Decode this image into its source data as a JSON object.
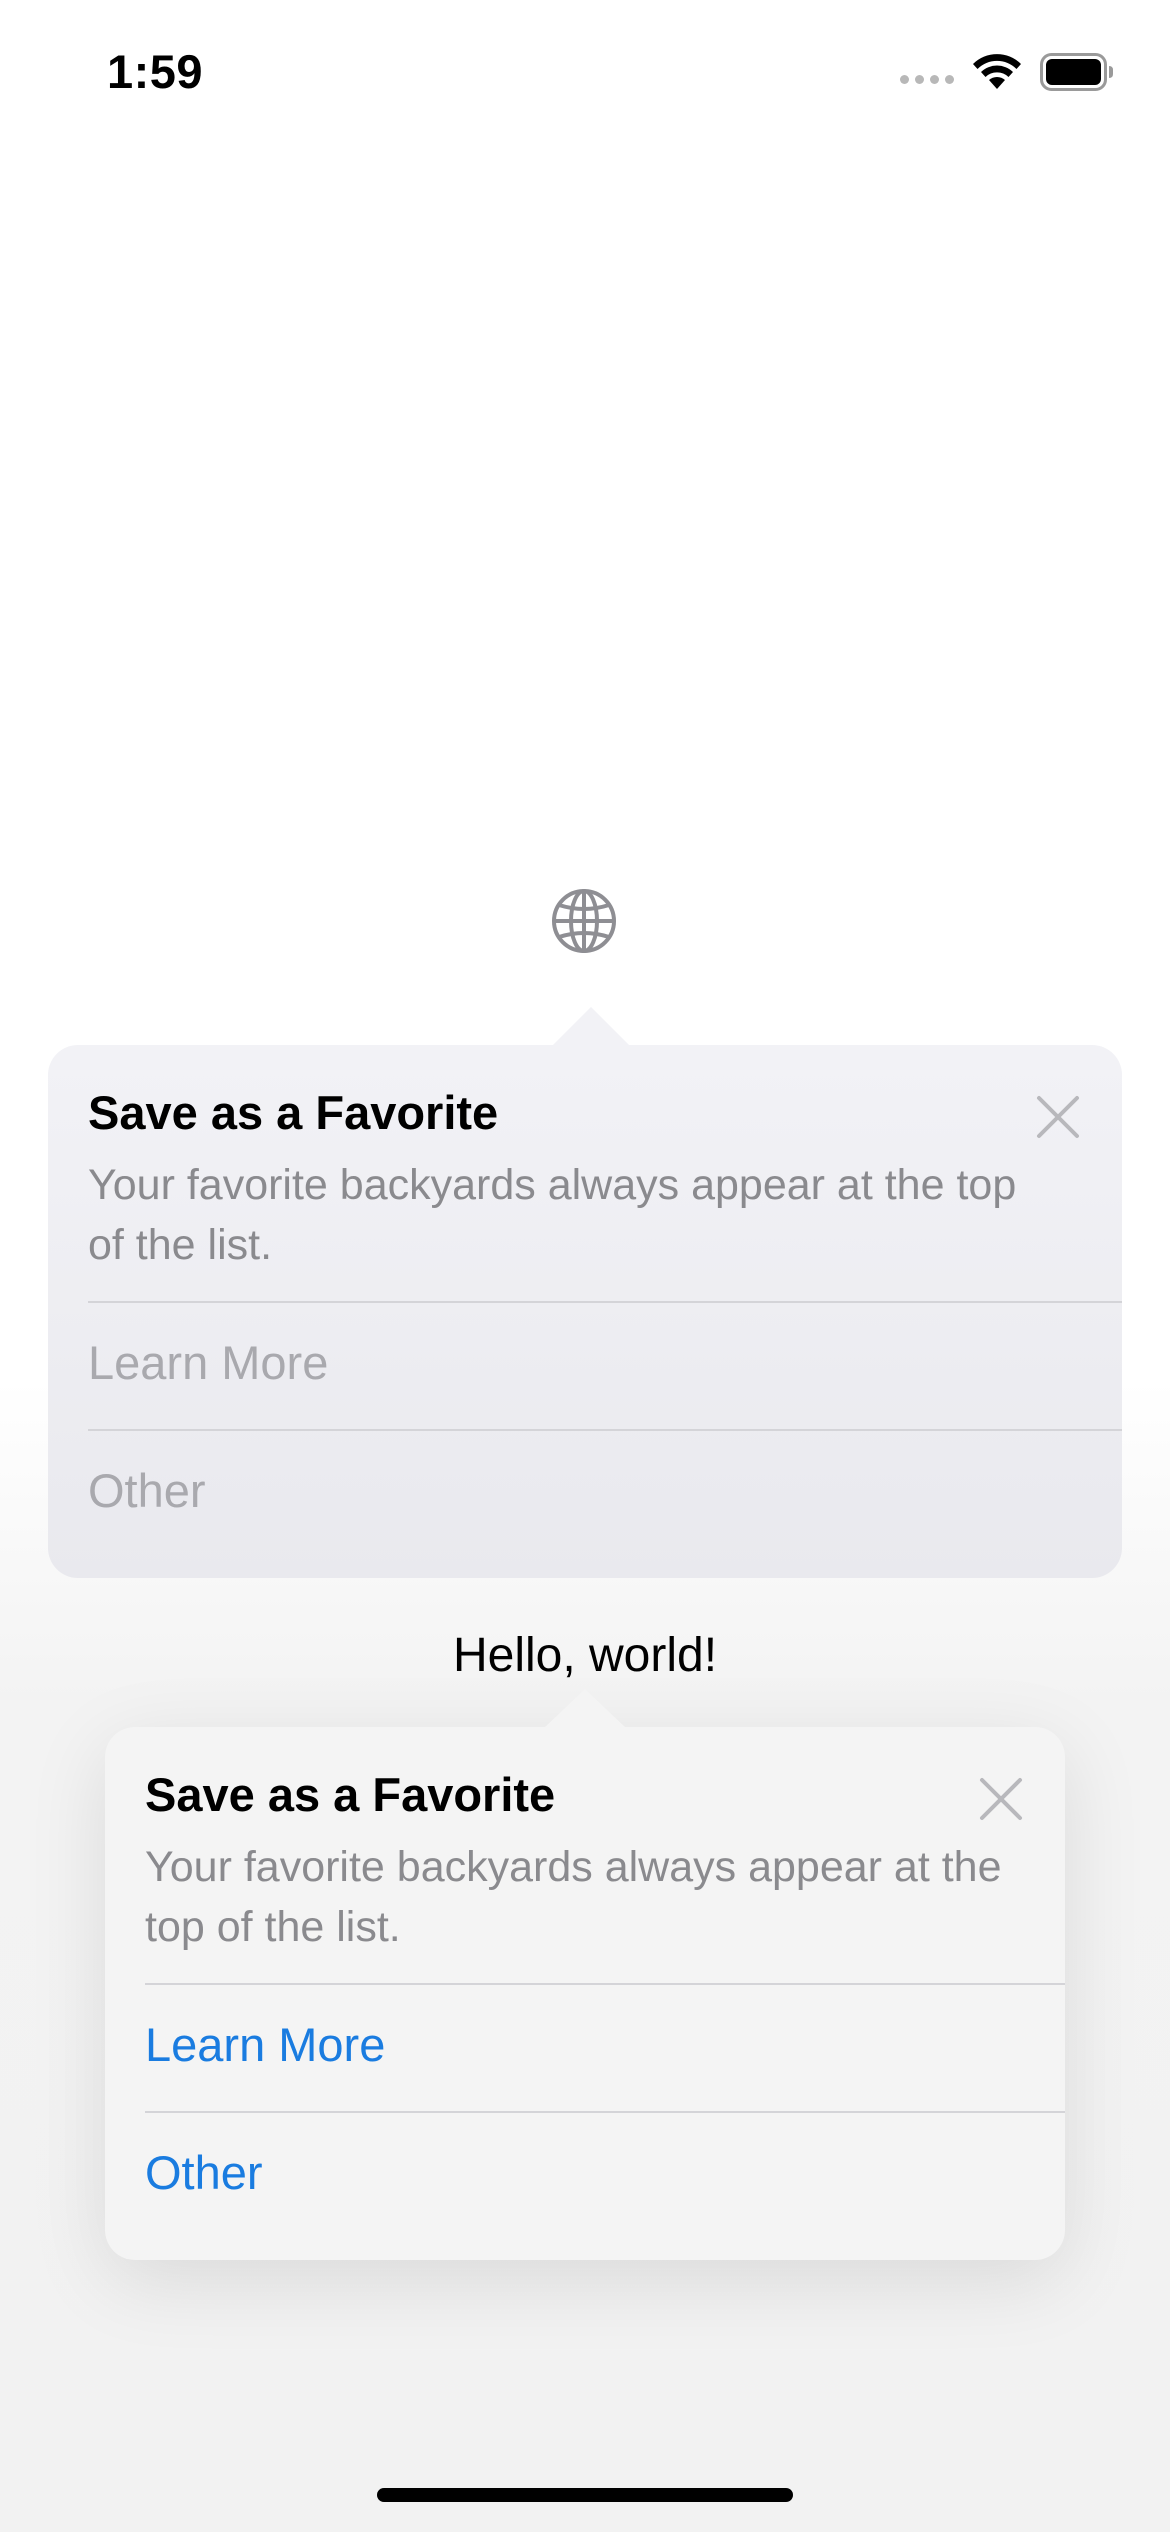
{
  "status_bar": {
    "time": "1:59"
  },
  "icons": {
    "globe": "globe-icon",
    "close": "xmark-icon",
    "wifi": "wifi-icon",
    "battery": "battery-icon"
  },
  "tips": [
    {
      "title": "Save as a Favorite",
      "message": "Your favorite backyards always appear at the top of the list.",
      "actions": [
        "Learn More",
        "Other"
      ],
      "state": "disabled"
    },
    {
      "title": "Save as a Favorite",
      "message": "Your favorite backyards always appear at the top of the list.",
      "actions": [
        "Learn More",
        "Other"
      ],
      "state": "enabled"
    }
  ],
  "main": {
    "hello_text": "Hello, world!"
  },
  "colors": {
    "action_enabled": "#1a7ce0",
    "action_disabled": "#a9a9ae",
    "message": "#8a8a8e"
  }
}
